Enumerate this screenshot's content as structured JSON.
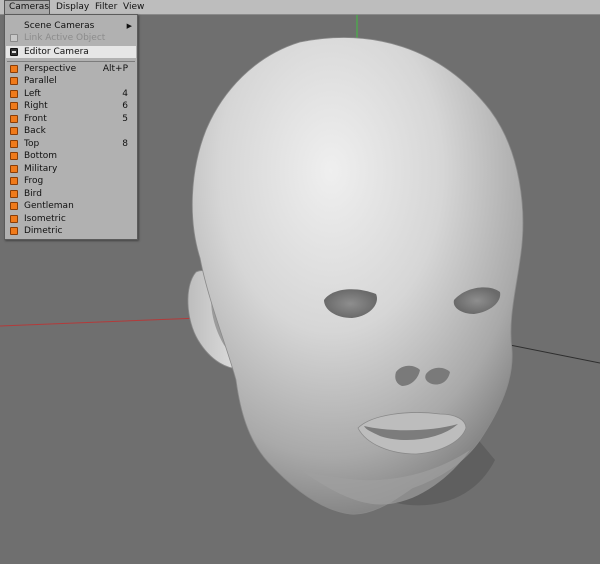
{
  "menubar": {
    "items": [
      {
        "label": "Cameras"
      },
      {
        "label": "Display"
      },
      {
        "label": "Filter"
      },
      {
        "label": "View"
      }
    ]
  },
  "cameras_menu": {
    "items": [
      {
        "label": "Scene Cameras",
        "shortcut": "",
        "icon": "none",
        "disabled": false,
        "submenu": true
      },
      {
        "label": "Link Active Object",
        "shortcut": "",
        "icon": "link-icon",
        "disabled": true
      },
      {
        "label": "Editor Camera",
        "shortcut": "",
        "icon": "camera-icon",
        "highlight": true
      },
      {
        "label": "Perspective",
        "shortcut": "Alt+P",
        "icon": "perspective-icon"
      },
      {
        "label": "Parallel",
        "shortcut": "",
        "icon": "parallel-icon"
      },
      {
        "label": "Left",
        "shortcut": "4",
        "icon": "left-view-icon"
      },
      {
        "label": "Right",
        "shortcut": "6",
        "icon": "right-view-icon"
      },
      {
        "label": "Front",
        "shortcut": "5",
        "icon": "front-view-icon"
      },
      {
        "label": "Back",
        "shortcut": "",
        "icon": "back-view-icon"
      },
      {
        "label": "Top",
        "shortcut": "8",
        "icon": "top-view-icon"
      },
      {
        "label": "Bottom",
        "shortcut": "",
        "icon": "bottom-view-icon"
      },
      {
        "label": "Military",
        "shortcut": "",
        "icon": "military-icon"
      },
      {
        "label": "Frog",
        "shortcut": "",
        "icon": "frog-icon"
      },
      {
        "label": "Bird",
        "shortcut": "",
        "icon": "bird-icon"
      },
      {
        "label": "Gentleman",
        "shortcut": "",
        "icon": "gentleman-icon"
      },
      {
        "label": "Isometric",
        "shortcut": "",
        "icon": "isometric-icon"
      },
      {
        "label": "Dimetric",
        "shortcut": "",
        "icon": "dimetric-icon"
      }
    ]
  },
  "colors": {
    "viewport_bg": "#6f6f6f",
    "menu_bg": "#b1b1b1",
    "highlight_bg": "#e6e6e6",
    "icon_orange": "#f07a1a",
    "axis_x": "#b33a3a",
    "axis_y": "#3fbf3f"
  }
}
